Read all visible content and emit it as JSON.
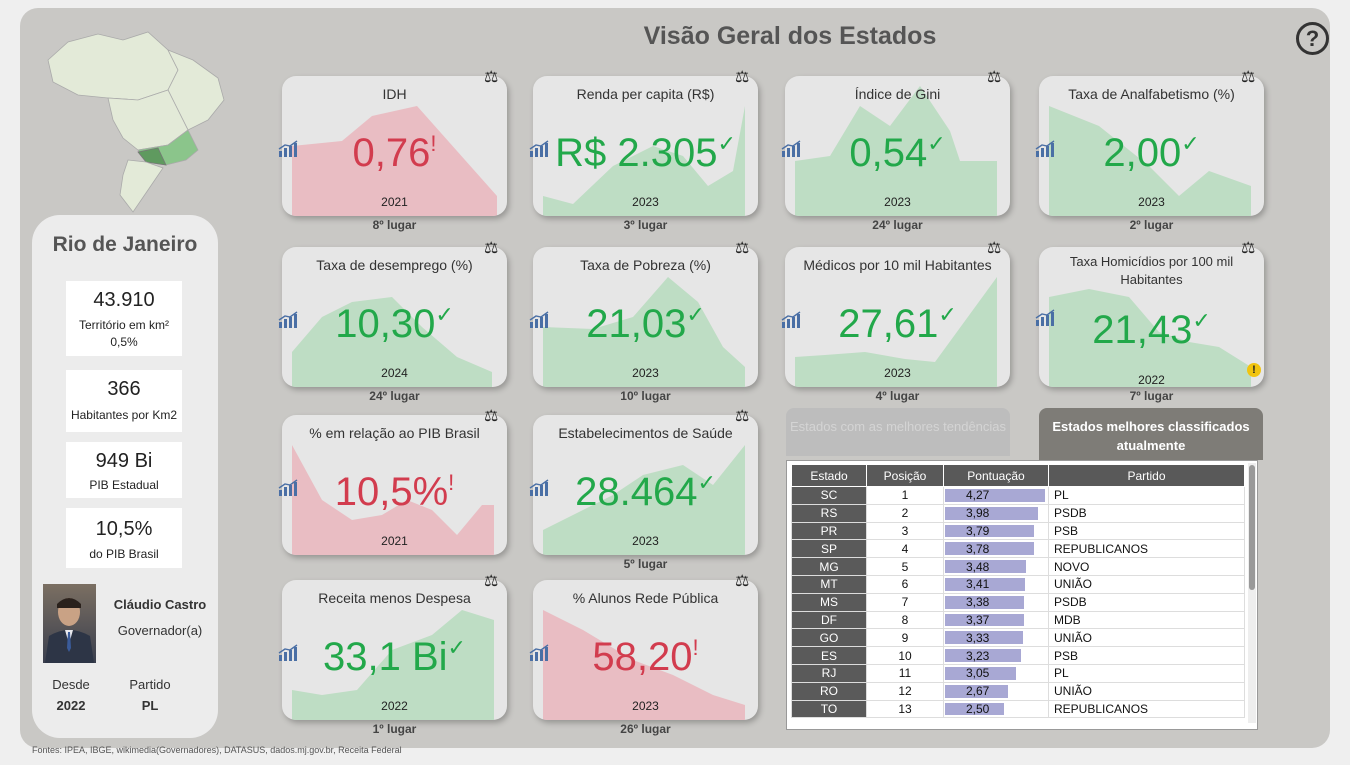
{
  "title": "Visão Geral dos Estados",
  "help_symbol": "?",
  "state": {
    "name": "Rio de Janeiro",
    "stats": [
      {
        "value": "43.910",
        "label": "Território em km²",
        "sub": "0,5%"
      },
      {
        "value": "366",
        "label": "Habitantes por Km2"
      },
      {
        "value": "949 Bi",
        "label": "PIB Estadual"
      },
      {
        "value": "10,5%",
        "label": "do PIB Brasil"
      }
    ],
    "governor": {
      "name": "Cláudio Castro",
      "role": "Governador(a)",
      "since_label": "Desde",
      "since": "2022",
      "party_label": "Partido",
      "party": "PL"
    }
  },
  "cards": [
    {
      "title": "IDH",
      "value": "0,76",
      "mark": "!",
      "status": "bad",
      "year": "2021",
      "rank": "8º lugar"
    },
    {
      "title": "Renda per capita (R$)",
      "value": "R$ 2.305",
      "mark": "✓",
      "status": "good",
      "year": "2023",
      "rank": "3º lugar"
    },
    {
      "title": "Índice de Gini",
      "value": "0,54",
      "mark": "✓",
      "status": "good",
      "year": "2023",
      "rank": "24º lugar"
    },
    {
      "title": "Taxa de Analfabetismo (%)",
      "value": "2,00",
      "mark": "✓",
      "status": "good",
      "year": "2023",
      "rank": "2º lugar"
    },
    {
      "title": "Taxa de desemprego (%)",
      "value": "10,30",
      "mark": "✓",
      "status": "good",
      "year": "2024",
      "rank": "24º lugar"
    },
    {
      "title": "Taxa de Pobreza (%)",
      "value": "21,03",
      "mark": "✓",
      "status": "good",
      "year": "2023",
      "rank": "10º lugar"
    },
    {
      "title": "Médicos por 10 mil Habitantes",
      "value": "27,61",
      "mark": "✓",
      "status": "good",
      "year": "2023",
      "rank": "4º lugar"
    },
    {
      "title": "Taxa Homicídios por 100 mil Habitantes",
      "value": "21,43",
      "mark": "✓",
      "status": "good",
      "year": "2022",
      "rank": "7º lugar",
      "warning": "!"
    },
    {
      "title": "% em relação ao PIB Brasil",
      "value": "10,5%",
      "mark": "!",
      "status": "bad",
      "year": "2021",
      "rank": ""
    },
    {
      "title": "Estabelecimentos de Saúde",
      "value": "28.464",
      "mark": "✓",
      "status": "good",
      "year": "2023",
      "rank": "5º lugar"
    },
    {
      "title": "Receita menos Despesa",
      "value": "33,1 Bi",
      "mark": "✓",
      "status": "good",
      "year": "2022",
      "rank": "1º lugar"
    },
    {
      "title": "% Alunos Rede Pública",
      "value": "58,20",
      "mark": "!",
      "status": "bad",
      "year": "2023",
      "rank": "26º lugar"
    }
  ],
  "tabs": {
    "trends": "Estados com as melhores tendências",
    "best": "Estados melhores classificados atualmente"
  },
  "ranking": {
    "columns": [
      "Estado",
      "Posição",
      "Pontuação",
      "Partido"
    ],
    "rows": [
      {
        "state": "SC",
        "pos": "1",
        "score": "4,27",
        "party": "PL"
      },
      {
        "state": "RS",
        "pos": "2",
        "score": "3,98",
        "party": "PSDB"
      },
      {
        "state": "PR",
        "pos": "3",
        "score": "3,79",
        "party": "PSB"
      },
      {
        "state": "SP",
        "pos": "4",
        "score": "3,78",
        "party": "REPUBLICANOS"
      },
      {
        "state": "MG",
        "pos": "5",
        "score": "3,48",
        "party": "NOVO"
      },
      {
        "state": "MT",
        "pos": "6",
        "score": "3,41",
        "party": "UNIÃO"
      },
      {
        "state": "MS",
        "pos": "7",
        "score": "3,38",
        "party": "PSDB"
      },
      {
        "state": "DF",
        "pos": "8",
        "score": "3,37",
        "party": "MDB"
      },
      {
        "state": "GO",
        "pos": "9",
        "score": "3,33",
        "party": "UNIÃO"
      },
      {
        "state": "ES",
        "pos": "10",
        "score": "3,23",
        "party": "PSB"
      },
      {
        "state": "RJ",
        "pos": "11",
        "score": "3,05",
        "party": "PL"
      },
      {
        "state": "RO",
        "pos": "12",
        "score": "2,67",
        "party": "UNIÃO"
      },
      {
        "state": "TO",
        "pos": "13",
        "score": "2,50",
        "party": "REPUBLICANOS"
      }
    ]
  },
  "footer": "Fontes: IPEA, IBGE, wikimedia(Governadores), DATASUS, dados.mj.gov.br, Receita Federal",
  "colors": {
    "good": "#22a84a",
    "bad": "#d23c4e",
    "good_area": "#b9dcc0",
    "bad_area": "#e9b8bf"
  }
}
